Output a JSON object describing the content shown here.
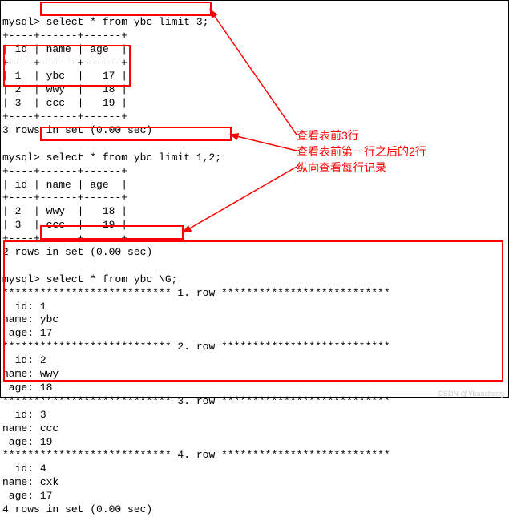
{
  "prompts": {
    "mysql": "mysql>"
  },
  "queries": {
    "q1": "select * from ybc limit 3;",
    "q2": "select * from ybc limit 1,2;",
    "q3": "select * from ybc \\G;"
  },
  "table1": {
    "headers": [
      "id",
      "name",
      "age"
    ],
    "rows": [
      {
        "id": "1",
        "name": "ybc",
        "age": "17"
      },
      {
        "id": "2",
        "name": "wwy",
        "age": "18"
      },
      {
        "id": "3",
        "name": "ccc",
        "age": "19"
      }
    ],
    "footer": "3 rows in set (0.00 sec)"
  },
  "table2": {
    "headers": [
      "id",
      "name",
      "age"
    ],
    "rows": [
      {
        "id": "2",
        "name": "wwy",
        "age": "18"
      },
      {
        "id": "3",
        "name": "ccc",
        "age": "19"
      }
    ],
    "footer": "2 rows in set (0.00 sec)"
  },
  "vertical": {
    "sep1": "*************************** 1. row ***************************",
    "sep2": "*************************** 2. row ***************************",
    "sep3": "*************************** 3. row ***************************",
    "sep4": "*************************** 4. row ***************************",
    "rows": [
      {
        "id_label": "  id:",
        "id": "1",
        "name_label": "name:",
        "name": "ybc",
        "age_label": " age:",
        "age": "17"
      },
      {
        "id_label": "  id:",
        "id": "2",
        "name_label": "name:",
        "name": "wwy",
        "age_label": " age:",
        "age": "18"
      },
      {
        "id_label": "  id:",
        "id": "3",
        "name_label": "name:",
        "name": "ccc",
        "age_label": " age:",
        "age": "19"
      },
      {
        "id_label": "  id:",
        "id": "4",
        "name_label": "name:",
        "name": "cxk",
        "age_label": " age:",
        "age": "17"
      }
    ],
    "footer": "4 rows in set (0.00 sec)"
  },
  "separators": {
    "line": "+----+------+------+",
    "header_row": "| id | name | age  |"
  },
  "annotations": {
    "a1": "查看表前3行",
    "a2": "查看表前第一行之后的2行",
    "a3": "纵向查看每行记录"
  },
  "watermark": "CSDN @Ybaocheng"
}
